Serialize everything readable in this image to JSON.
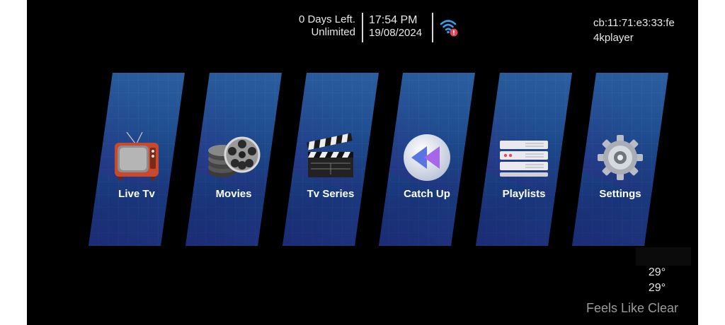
{
  "status": {
    "days_left": "0 Days Left.",
    "plan": "Unlimited",
    "time": "17:54 PM",
    "date": "19/08/2024",
    "wifi_icon": "wifi-icon"
  },
  "device": {
    "mac": "cb:11:71:e3:33:fe",
    "app": "4kplayer"
  },
  "menu": [
    {
      "label": "Live Tv",
      "icon": "tv-icon"
    },
    {
      "label": "Movies",
      "icon": "film-reel-icon"
    },
    {
      "label": "Tv Series",
      "icon": "clapperboard-icon"
    },
    {
      "label": "Catch Up",
      "icon": "rewind-icon"
    },
    {
      "label": "Playlists",
      "icon": "server-stack-icon"
    },
    {
      "label": "Settings",
      "icon": "gear-icon"
    }
  ],
  "weather": {
    "temp": "29°",
    "feels_temp": "29°",
    "feels_label": "Feels Like Clear"
  },
  "colors": {
    "background": "#000000",
    "tile": "#1a4687",
    "wifi": "#3b9be8",
    "alert": "#e0455a"
  }
}
